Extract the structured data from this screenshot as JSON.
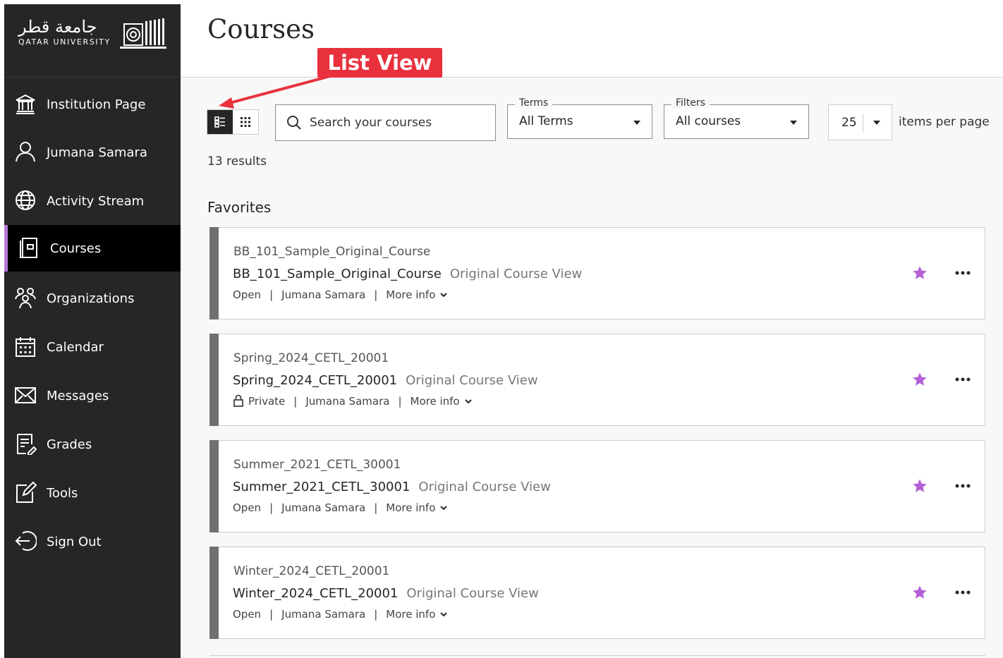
{
  "logo": {
    "arabic": "جامعة قطر",
    "english": "QATAR UNIVERSITY"
  },
  "sidebar": {
    "items": [
      {
        "label": "Institution Page",
        "icon": "institution-icon"
      },
      {
        "label": "Jumana Samara",
        "icon": "user-icon"
      },
      {
        "label": "Activity Stream",
        "icon": "globe-icon"
      },
      {
        "label": "Courses",
        "icon": "courses-icon",
        "active": true
      },
      {
        "label": "Organizations",
        "icon": "organizations-icon"
      },
      {
        "label": "Calendar",
        "icon": "calendar-icon"
      },
      {
        "label": "Messages",
        "icon": "envelope-icon"
      },
      {
        "label": "Grades",
        "icon": "grades-icon"
      },
      {
        "label": "Tools",
        "icon": "tools-icon"
      },
      {
        "label": "Sign Out",
        "icon": "sign-out-icon"
      }
    ]
  },
  "header": {
    "title": "Courses"
  },
  "annotation": {
    "label": "List View",
    "color": "#e8313d"
  },
  "toolbar": {
    "search_placeholder": "Search your courses",
    "terms": {
      "label": "Terms",
      "value": "All Terms"
    },
    "filters": {
      "label": "Filters",
      "value": "All courses"
    },
    "per_page": {
      "value": "25",
      "label": "items per page"
    }
  },
  "results": "13 results",
  "favorites_heading": "Favorites",
  "courses": [
    {
      "id": "BB_101_Sample_Original_Course",
      "name": "BB_101_Sample_Original_Course",
      "view": "Original Course View",
      "status": "Open",
      "instructor": "Jumana Samara",
      "more": "More info"
    },
    {
      "id": "Spring_2024_CETL_20001",
      "name": "Spring_2024_CETL_20001",
      "view": "Original Course View",
      "status": "Private",
      "instructor": "Jumana Samara",
      "more": "More info"
    },
    {
      "id": "Summer_2021_CETL_30001",
      "name": "Summer_2021_CETL_30001",
      "view": "Original Course View",
      "status": "Open",
      "instructor": "Jumana Samara",
      "more": "More info"
    },
    {
      "id": "Winter_2024_CETL_20001",
      "name": "Winter_2024_CETL_20001",
      "view": "Original Course View",
      "status": "Open",
      "instructor": "Jumana Samara",
      "more": "More info"
    }
  ],
  "colors": {
    "sidebar_bg": "#262626",
    "active_accent": "#b47ad6",
    "star": "#b45fd6",
    "card_strip": "#707070"
  }
}
